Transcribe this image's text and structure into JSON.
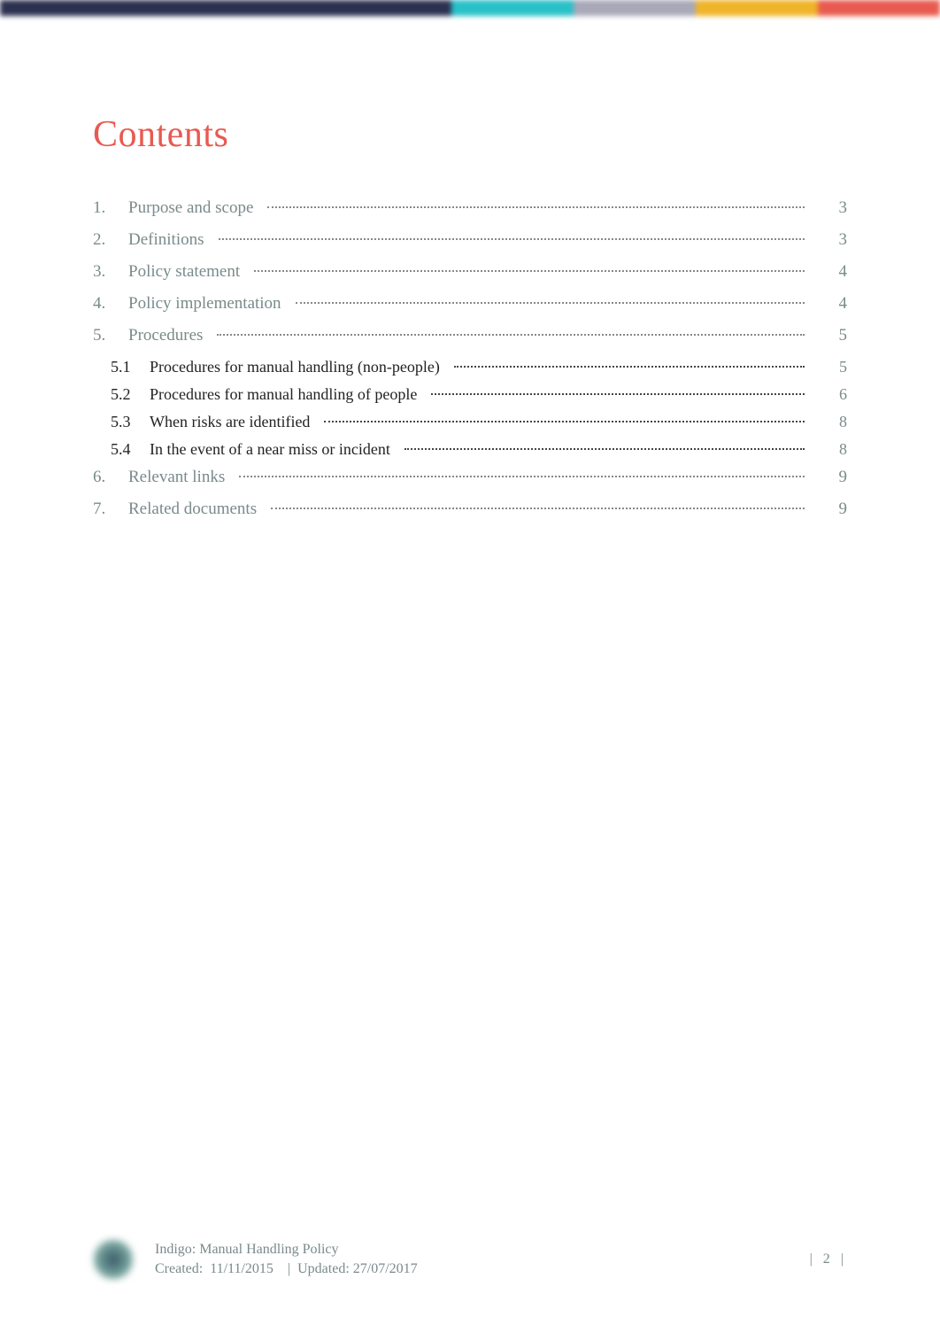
{
  "title": "Contents",
  "toc": [
    {
      "level": 1,
      "num": "1.",
      "label": "Purpose and scope",
      "page": "3"
    },
    {
      "level": 1,
      "num": "2.",
      "label": "Definitions",
      "page": "3"
    },
    {
      "level": 1,
      "num": "3.",
      "label": "Policy statement",
      "page": "4"
    },
    {
      "level": 1,
      "num": "4.",
      "label": "Policy implementation",
      "page": "4"
    },
    {
      "level": 1,
      "num": "5.",
      "label": "Procedures",
      "page": "5"
    },
    {
      "level": 2,
      "num": "5.1",
      "label": "Procedures for manual handling (non-people)",
      "page": "5"
    },
    {
      "level": 2,
      "num": "5.2",
      "label": "Procedures for manual handling of people",
      "page": "6"
    },
    {
      "level": 2,
      "num": "5.3",
      "label": "When risks are identified",
      "page": "8"
    },
    {
      "level": 2,
      "num": "5.4",
      "label": "In the event of a near miss or incident",
      "page": "8"
    },
    {
      "level": 1,
      "num": "6.",
      "label": "Relevant links",
      "page": "9"
    },
    {
      "level": 1,
      "num": "7.",
      "label": "Related documents",
      "page": "9"
    }
  ],
  "footer": {
    "doc_title": "Indigo: Manual Handling Policy",
    "created_label": "Created:",
    "created_date": "11/11/2015",
    "sep": "|",
    "updated_label": "Updated:",
    "updated_date": "27/07/2017",
    "page_display": "| 2 |"
  }
}
